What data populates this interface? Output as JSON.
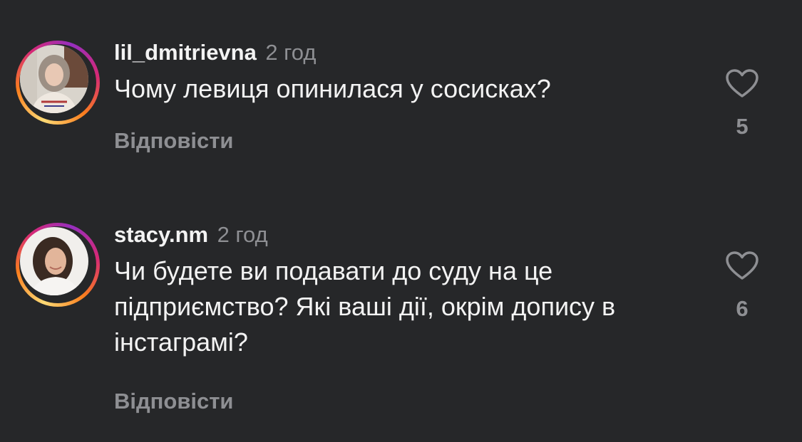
{
  "comments": [
    {
      "username": "lil_dmitrievna",
      "time": "2 год",
      "text": "Чому левиця опинилася у сосисках?",
      "reply_label": "Відповісти",
      "likes": "5",
      "like_icon": "heart-outline-icon"
    },
    {
      "username": "stacy.nm",
      "time": "2 год",
      "text": "Чи будете ви подавати до суду на це підприємство? Які ваші дії, окрім допису в інстаграмі?",
      "reply_label": "Відповісти",
      "likes": "6",
      "like_icon": "heart-outline-icon"
    }
  ],
  "colors": {
    "background": "#262729",
    "primary_text": "#f3f3f3",
    "secondary_text": "#8e8f93",
    "story_ring": [
      "#feda75",
      "#fa7e1e",
      "#d62976",
      "#962fbf"
    ]
  }
}
